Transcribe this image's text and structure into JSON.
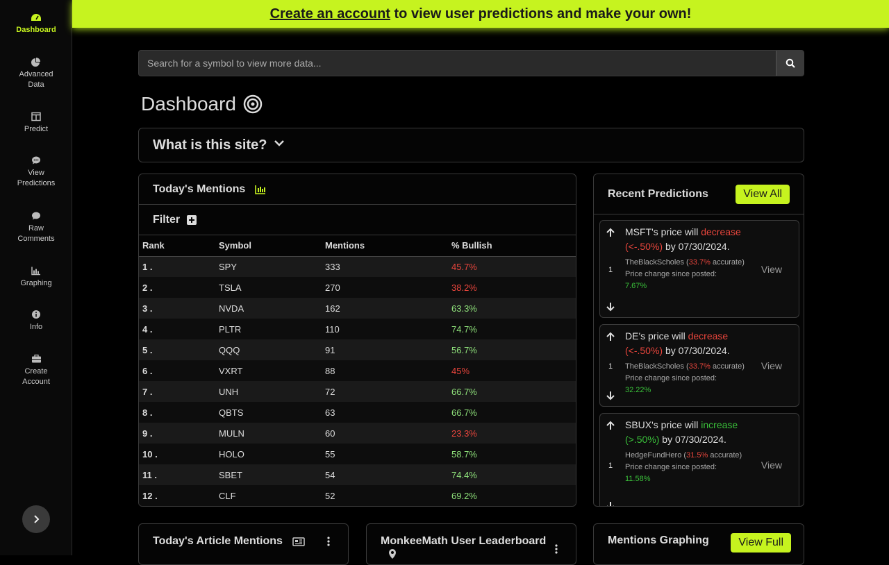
{
  "sidebar": {
    "items": [
      {
        "label": "Dashboard",
        "icon": "gauge-icon",
        "active": true
      },
      {
        "label": "Advanced Data",
        "icon": "pie-chart-icon"
      },
      {
        "label": "Predict",
        "icon": "table-icon"
      },
      {
        "label": "View Predictions",
        "icon": "comment-icon"
      },
      {
        "label": "Raw Comments",
        "icon": "comment-icon"
      },
      {
        "label": "Graphing",
        "icon": "bar-chart-icon"
      },
      {
        "label": "Info",
        "icon": "info-icon"
      },
      {
        "label": "Create Account",
        "icon": "briefcase-icon"
      }
    ]
  },
  "banner": {
    "link": "Create an account",
    "text": " to view user predictions and make your own!"
  },
  "search": {
    "placeholder": "Search for a symbol to view more data..."
  },
  "page": {
    "title": "Dashboard"
  },
  "about": {
    "title": "What is this site?"
  },
  "mentions": {
    "title": "Today's Mentions",
    "filter_label": "Filter",
    "columns": [
      "Rank",
      "Symbol",
      "Mentions",
      "% Bullish"
    ],
    "rows": [
      {
        "rank": "1 .",
        "symbol": "SPY",
        "mentions": "333",
        "bullish": "45.7%",
        "tone": "red"
      },
      {
        "rank": "2 .",
        "symbol": "TSLA",
        "mentions": "270",
        "bullish": "38.2%",
        "tone": "red"
      },
      {
        "rank": "3 .",
        "symbol": "NVDA",
        "mentions": "162",
        "bullish": "63.3%",
        "tone": "green"
      },
      {
        "rank": "4 .",
        "symbol": "PLTR",
        "mentions": "110",
        "bullish": "74.7%",
        "tone": "green"
      },
      {
        "rank": "5 .",
        "symbol": "QQQ",
        "mentions": "91",
        "bullish": "56.7%",
        "tone": "green"
      },
      {
        "rank": "6 .",
        "symbol": "VXRT",
        "mentions": "88",
        "bullish": "45%",
        "tone": "red"
      },
      {
        "rank": "7 .",
        "symbol": "UNH",
        "mentions": "72",
        "bullish": "66.7%",
        "tone": "green"
      },
      {
        "rank": "8 .",
        "symbol": "QBTS",
        "mentions": "63",
        "bullish": "66.7%",
        "tone": "green"
      },
      {
        "rank": "9 .",
        "symbol": "MULN",
        "mentions": "60",
        "bullish": "23.3%",
        "tone": "red"
      },
      {
        "rank": "10 .",
        "symbol": "HOLO",
        "mentions": "55",
        "bullish": "58.7%",
        "tone": "green"
      },
      {
        "rank": "11 .",
        "symbol": "SBET",
        "mentions": "54",
        "bullish": "74.4%",
        "tone": "green"
      },
      {
        "rank": "12 .",
        "symbol": "CLF",
        "mentions": "52",
        "bullish": "69.2%",
        "tone": "green"
      }
    ]
  },
  "recent": {
    "title": "Recent Predictions",
    "view_all": "View All",
    "view_label": "View",
    "predictions": [
      {
        "votes": "1",
        "pre": "MSFT's price will ",
        "direction": "decrease (<-.50%)",
        "direction_tone": "red",
        "post": " by 07/30/2024.",
        "user": "TheBlackScholes",
        "accuracy": "33.7%",
        "accuracy_suffix": "accurate)",
        "change_label": "Price change since posted:",
        "change": "7.67%"
      },
      {
        "votes": "1",
        "pre": "DE's price will ",
        "direction": "decrease (<-.50%)",
        "direction_tone": "red",
        "post": " by 07/30/2024.",
        "user": "TheBlackScholes",
        "accuracy": "33.7%",
        "accuracy_suffix": "accurate)",
        "change_label": "Price change since posted:",
        "change": "32.22%"
      },
      {
        "votes": "1",
        "pre": "SBUX's price will ",
        "direction": "increase (>.50%)",
        "direction_tone": "green",
        "post": " by 07/30/2024.",
        "user": "HedgeFundHero",
        "accuracy": "31.5%",
        "accuracy_suffix": "accurate)",
        "change_label": "Price change since posted:",
        "change": "11.58%"
      }
    ]
  },
  "bottom": {
    "articles_title": "Today's Article Mentions",
    "leaderboard_title": "MonkeeMath User Leaderboard",
    "graphing_title": "Mentions Graphing",
    "view_full": "View Full"
  },
  "colors": {
    "accent": "#c6f31f",
    "red": "#e8453c",
    "green": "#8ee07a"
  }
}
